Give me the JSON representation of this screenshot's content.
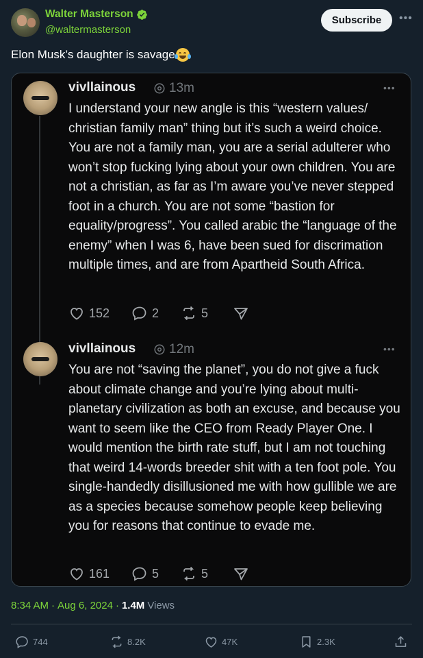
{
  "author": {
    "display_name": "Walter Masterson",
    "handle": "@waltermasterson",
    "verified": true,
    "accent_color": "#7dd43a"
  },
  "subscribe_label": "Subscribe",
  "tweet": {
    "text": "Elon Musk’s daughter is savage",
    "emoji": "face-with-tears-of-joy"
  },
  "embedded_replies": [
    {
      "name": "vivllainous",
      "time": "13m",
      "body": "I understand your new angle is this “western values/ christian family man” thing but it’s such a weird choice. You are not a family man, you are a serial adulterer who won’t stop fucking lying about your own children. You are not a christian, as far as I’m aware you’ve never stepped foot in a church. You are not some “bastion for equality/progress”. You called arabic the “language of the enemy” when I was 6, have been sued for discrimation multiple times, and are from Apartheid South Africa.",
      "likes": "152",
      "replies": "2",
      "reposts": "5"
    },
    {
      "name": "vivllainous",
      "time": "12m",
      "body": "You are not “saving the planet”, you do not give a fuck about climate change and you’re lying about multi-planetary civilization as both an excuse, and because you want to seem like the CEO from Ready Player One. I would mention the birth rate stuff, but I am not touching that weird 14-words breeder shit with a ten foot pole. You single-handedly disillusioned me with how gullible we are as a species because somehow people keep believing you for reasons that continue to evade me.",
      "likes": "161",
      "replies": "5",
      "reposts": "5"
    }
  ],
  "meta": {
    "time": "8:34 AM",
    "date": "Aug 6, 2024",
    "views_count": "1.4M",
    "views_label": "Views"
  },
  "actions": {
    "replies": "744",
    "reposts": "8.2K",
    "likes": "47K",
    "bookmarks": "2.3K"
  }
}
